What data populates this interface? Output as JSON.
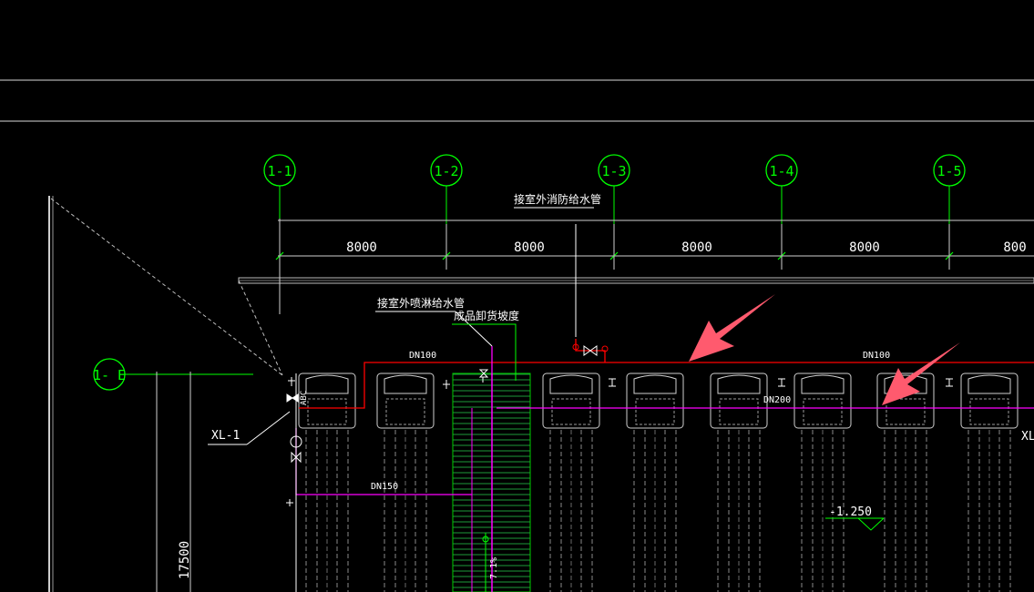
{
  "grid_axes": [
    {
      "label": "1-1"
    },
    {
      "label": "1-2"
    },
    {
      "label": "1-3"
    },
    {
      "label": "1-4"
    },
    {
      "label": "1-5"
    }
  ],
  "row_axis": {
    "label": "1- E"
  },
  "dimensions": {
    "spans": [
      "8000",
      "8000",
      "8000",
      "8000",
      "800"
    ],
    "vertical": "17500"
  },
  "annotations": {
    "outdoor_fire_water": "接室外消防给水管",
    "outdoor_sprinkler_water": "接室外喷淋给水管",
    "loading_ramp": "成品卸货坡度",
    "pipe_dn100_left": "DN100",
    "pipe_dn100_right": "DN100",
    "pipe_dn200": "DN200",
    "pipe_dn150": "DN150",
    "riser_label": "XL-1",
    "riser_label_right": "XL",
    "elevation": "-1.250",
    "slope": "7.1%",
    "pump_code": "ABC"
  },
  "colors": {
    "background": "#000000",
    "axis_green": "#00ff00",
    "linework": "#ffffff",
    "fire_pipe_red": "#ff0000",
    "sprinkler_pipe_magenta": "#ff00ff",
    "highlight_arrow": "#ff5a6e"
  }
}
